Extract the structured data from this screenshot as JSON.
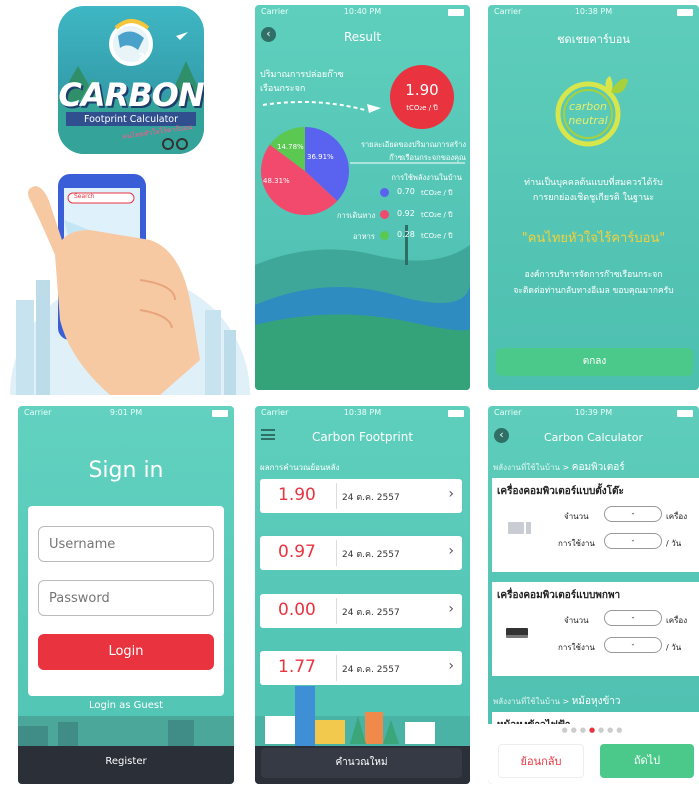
{
  "colors": {
    "teal": "#5dcab8",
    "teal_dark": "#3aa79b",
    "green": "#4bc98a",
    "red": "#e9333f",
    "yellow": "#f4d13a",
    "blue": "#5a63f0",
    "pink": "#f24a6d",
    "pie_green": "#5ac851"
  },
  "logo": {
    "title": "CARBON",
    "subtitle": "Footprint Calculator",
    "tagline": "คนไทยหัวใจไร้คาร์บอน",
    "c2": "2"
  },
  "phone": {
    "search_text": "Search"
  },
  "result": {
    "status": {
      "carrier": "Carrier",
      "time": "10:40 PM"
    },
    "title": "Result",
    "emission_label_1": "ปริมาณการปล่อยก๊าซ",
    "emission_label_2": "เรือนกระจก",
    "total": "1.90",
    "total_unit": "tCO₂e / ปี",
    "detail_1": "รายละเอียดของปริมาณการสร้าง",
    "detail_2": "ก๊าซเรือนกระจกของคุณ",
    "items": [
      {
        "label": "การใช้พลังงานในบ้าน",
        "value": "0.70",
        "unit": "tCO₂e / ปี",
        "color": "#5a63f0"
      },
      {
        "label": "การเดินทาง",
        "value": "0.92",
        "unit": "tCO₂e / ปี",
        "color": "#f24a6d"
      },
      {
        "label": "อาหาร",
        "value": "0.28",
        "unit": "tCO₂e / ปี",
        "color": "#5ac851"
      }
    ],
    "pie": [
      {
        "percent": "36.91%",
        "value": 36.91
      },
      {
        "percent": "48.31%",
        "value": 48.31
      },
      {
        "percent": "14.78%",
        "value": 14.78
      }
    ]
  },
  "offset": {
    "status": {
      "carrier": "Carrier",
      "time": "10:38 PM"
    },
    "title": "ชดเชยคาร์บอน",
    "badge_1": "carbon",
    "badge_2": "neutral",
    "msg_1": "ท่านเป็นบุคคลต้นแบบที่สมควรได้รับ",
    "msg_2": "การยกย่องเชิดชูเกียรติ ในฐานะ",
    "slogan": "\"คนไทยหัวใจไร้คาร์บอน\"",
    "org_1": "องค์การบริหารจัดการก๊าซเรือนกระจก",
    "org_2": "จะติดต่อท่านกลับทางอีเมล ขอบคุณมากครับ",
    "ok": "ตกลง"
  },
  "signin": {
    "status": {
      "carrier": "Carrier",
      "time": "9:01 PM"
    },
    "title": "Sign in",
    "username_ph": "Username",
    "password_ph": "Password",
    "login": "Login",
    "guest": "Login as Guest",
    "register": "Register"
  },
  "footprint": {
    "status": {
      "carrier": "Carrier",
      "time": "10:38 PM"
    },
    "title": "Carbon Footprint",
    "history_label": "ผลการคำนวณย้อนหลัง",
    "rows": [
      {
        "value": "1.90",
        "date": "24 ต.ค. 2557"
      },
      {
        "value": "0.97",
        "date": "24 ต.ค. 2557"
      },
      {
        "value": "0.00",
        "date": "24 ต.ค. 2557"
      },
      {
        "value": "1.77",
        "date": "24 ต.ค. 2557"
      }
    ],
    "new_calc": "คำนวณใหม่"
  },
  "calculator": {
    "status": {
      "carrier": "Carrier",
      "time": "10:39 PM"
    },
    "title": "Carbon Calculator",
    "crumb_1": "พลังงานที่ใช้ในบ้าน",
    "crumb_sep": ">",
    "crumb_2": "คอมพิวเตอร์",
    "card1_title": "เครื่องคอมพิวเตอร์แบบตั้งโต๊ะ",
    "card2_title": "เครื่องคอมพิวเตอร์แบบพกพา",
    "qty_label": "จำนวน",
    "use_label": "การใช้งาน",
    "field_val": "-",
    "qty_unit": "เครื่อง",
    "use_unit": "/ วัน",
    "crumb2_1": "พลังงานที่ใช้ในบ้าน",
    "crumb2_2": "หม้อหุงข้าว",
    "next_title": "หม้อหุงข้าวไฟฟ้า",
    "back": "ย้อนกลับ",
    "next": "ถัดไป"
  }
}
